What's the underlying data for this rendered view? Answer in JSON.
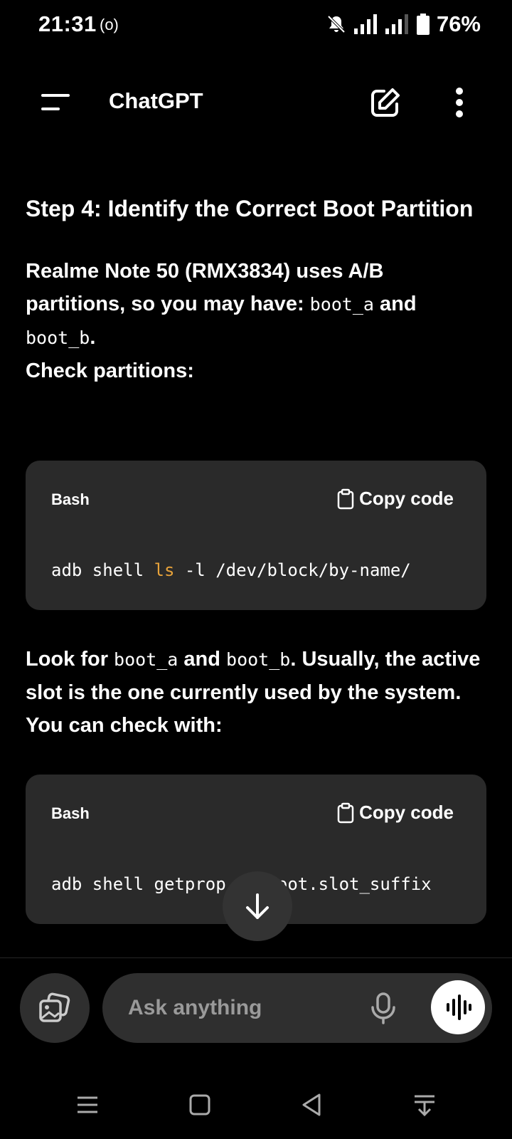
{
  "status_bar": {
    "time": "21:31",
    "hotspot": "(o)",
    "battery": "76%"
  },
  "header": {
    "title": "ChatGPT"
  },
  "content": {
    "step_title": "Step 4: Identify the Correct Boot Partition",
    "para1_text1": "Realme Note 50 (RMX3834) uses A/B partitions, so you may have: ",
    "para1_code1": "boot_a",
    "para1_text2": " and ",
    "para1_code2": "boot_b",
    "para1_text3": ".",
    "para1_line2": "Check partitions:",
    "code_block_1": {
      "language": "Bash",
      "copy_label": "Copy code",
      "code_pre": "adb shell ",
      "code_kw": "ls",
      "code_post": " -l /dev/block/by-name/"
    },
    "para2_text1": "Look for ",
    "para2_code1": "boot_a",
    "para2_text2": " and ",
    "para2_code2": "boot_b",
    "para2_text3": ". Usually, the active slot is the one currently used by the system. You can check with:",
    "code_block_2": {
      "language": "Bash",
      "copy_label": "Copy code",
      "code": "adb shell getprop ro.boot.slot_suffix"
    }
  },
  "composer": {
    "placeholder": "Ask anything"
  },
  "icons": {
    "menu": "menu-icon",
    "edit": "new-chat-icon",
    "more": "more-vertical-icon",
    "copy": "clipboard-icon",
    "scroll": "arrow-down-icon",
    "attach": "images-icon",
    "mic": "mic-icon",
    "voice": "voice-waveform-icon"
  },
  "colors": {
    "background": "#000000",
    "code_bg": "#2a2a2a",
    "keyword": "#e8a33a",
    "input_bg": "#2f2f2f"
  }
}
